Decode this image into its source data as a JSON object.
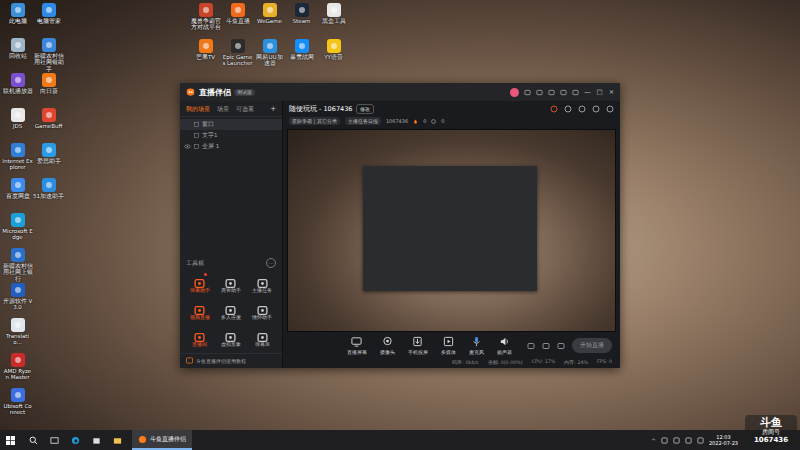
{
  "desktop": {
    "column_a": [
      {
        "label": "此电脑",
        "color": "#3b8fd9"
      },
      {
        "label": "回收站",
        "color": "#9fb6c8"
      },
      {
        "label": "联机播放器",
        "color": "#7a4fd0"
      },
      {
        "label": "JDS",
        "color": "#e8e8e8"
      },
      {
        "label": "Internet Explorer",
        "color": "#2f7fd6"
      },
      {
        "label": "百度网盘",
        "color": "#3c8cf0"
      },
      {
        "label": "Microsoft Edge",
        "color": "#1b9fd8"
      },
      {
        "label": "新疆农村信用社网上银行",
        "color": "#2a6fc9"
      },
      {
        "label": "开源软件 V3.0",
        "color": "#1f5fbf"
      },
      {
        "label": "Translatio...",
        "color": "#dfe6ee"
      },
      {
        "label": "AMD Ryzen Master",
        "color": "#c92a2a"
      },
      {
        "label": "Ubisoft Connect",
        "color": "#3a6fe0"
      }
    ],
    "column_b": [
      {
        "label": "电脑管家",
        "color": "#2f8ae6"
      },
      {
        "label": "新疆农村信用社网银助手",
        "color": "#3a86d9"
      },
      {
        "label": "向日葵",
        "color": "#f07a1a"
      },
      {
        "label": "GameBuff",
        "color": "#e0452f"
      },
      {
        "label": "爱思助手",
        "color": "#2b9be8"
      },
      {
        "label": "51加速助手",
        "color": "#2a8de0"
      }
    ],
    "top_row_1": [
      {
        "label": "魔兽争霸官方对战平台",
        "color": "#c8442a"
      },
      {
        "label": "斗鱼直播",
        "color": "#f26b1d"
      },
      {
        "label": "WeGame",
        "color": "#e8b02a"
      },
      {
        "label": "Steam",
        "color": "#1b2838"
      },
      {
        "label": "黑盒工具",
        "color": "#e8e8e8"
      }
    ],
    "top_row_2": [
      {
        "label": "芒果TV",
        "color": "#f07a1a"
      },
      {
        "label": "Epic Games Launcher",
        "color": "#2b2b2b"
      },
      {
        "label": "网易UU加速器",
        "color": "#2a90e0"
      },
      {
        "label": "暴雪战网",
        "color": "#148eff"
      },
      {
        "label": "YY语音",
        "color": "#f5c518"
      }
    ]
  },
  "app": {
    "title": "直播伴侣",
    "badge": "测试版",
    "window_controls": [
      "—",
      "□",
      "×"
    ],
    "scene_tabs": [
      {
        "label": "我的场景",
        "selected": true
      },
      {
        "label": "场景",
        "selected": false
      },
      {
        "label": "可选素",
        "selected": false
      }
    ],
    "add_scene": "+",
    "layers": [
      {
        "label": "窗口",
        "visible": false,
        "selected": true
      },
      {
        "label": "文字1",
        "visible": false,
        "selected": false
      },
      {
        "label": "全屏 1",
        "visible": true,
        "selected": false
      }
    ],
    "toolbox": {
      "title": "工具箱",
      "more": "…",
      "tools": [
        {
          "label": "弹幕助手",
          "color": "#ff5a1f",
          "badge": true
        },
        {
          "label": "房管助手",
          "color": "#c8c8c8",
          "badge": false
        },
        {
          "label": "主播任务",
          "color": "#c8c8c8",
          "badge": false
        },
        {
          "label": "视频直播",
          "color": "#ff5a1f",
          "badge": false
        },
        {
          "label": "多人连麦",
          "color": "#c8c8c8",
          "badge": false
        },
        {
          "label": "情怀助手",
          "color": "#c8c8c8",
          "badge": false
        },
        {
          "label": "直播间",
          "color": "#ff5a1f",
          "badge": false
        },
        {
          "label": "虚拟形象",
          "color": "#c8c8c8",
          "badge": false
        },
        {
          "label": "弹幕库",
          "color": "#c8c8c8",
          "badge": false
        }
      ]
    },
    "tutorial": "斗鱼直播伴侣使用教程",
    "room": {
      "title": "随便玩玩 - 1067436",
      "edit": "修改",
      "category": "星际争霸 | 其它分类",
      "task": "主播任务日报",
      "room_id": "1067436",
      "heat": "0",
      "fans": "0"
    },
    "toolbar": [
      {
        "label": "直播屏幕",
        "kind": "screen"
      },
      {
        "label": "摄像头",
        "kind": "camera"
      },
      {
        "label": "手机投屏",
        "kind": "phone"
      },
      {
        "label": "多媒体",
        "kind": "media"
      },
      {
        "label": "麦克风",
        "kind": "mic"
      },
      {
        "label": "扬声器",
        "kind": "speaker"
      }
    ],
    "start_button": {
      "label": "开始直播",
      "disabled": true
    },
    "status": [
      "码率: 0kb/s",
      "丢帧: 0(0.00%)",
      "CPU: 17%",
      "内存: 24%",
      "FPS: 0"
    ]
  },
  "taskbar": {
    "apps": [
      {
        "label": "斗鱼直播伴侣",
        "selected": true
      }
    ],
    "tray_arrow": "^",
    "clock": {
      "time": "12:03",
      "date": "2022-07-23"
    }
  },
  "watermark": {
    "brand": "斗鱼",
    "label": "房间号",
    "room_id": "1067436"
  }
}
